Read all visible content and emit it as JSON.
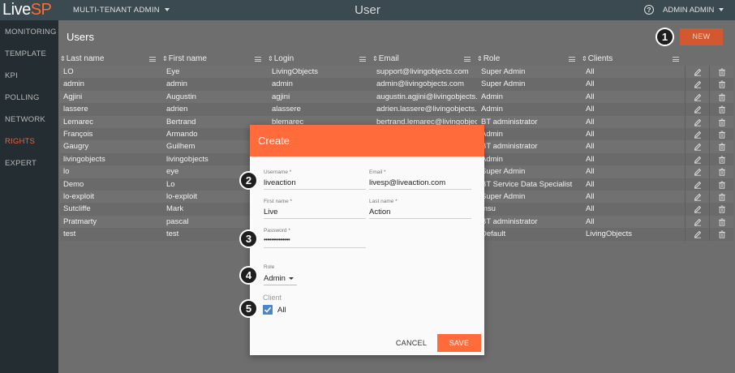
{
  "topbar": {
    "logo_live": "Live",
    "logo_sp": "SP",
    "tenant": "MULTI-TENANT ADMIN",
    "title": "User",
    "help": "?",
    "user": "ADMIN ADMIN"
  },
  "sidebar": {
    "items": [
      {
        "label": "MONITORING"
      },
      {
        "label": "TEMPLATE"
      },
      {
        "label": "KPI"
      },
      {
        "label": "POLLING"
      },
      {
        "label": "NETWORK"
      },
      {
        "label": "RIGHTS"
      },
      {
        "label": "EXPERT"
      }
    ]
  },
  "main": {
    "title": "Users",
    "new_button": "NEW",
    "columns": [
      "Last name",
      "First name",
      "Login",
      "Email",
      "Role",
      "Clients"
    ],
    "rows": [
      [
        "LO",
        "Eye",
        "LivingObjects",
        "support@livingobjects.com",
        "Super Admin",
        "All"
      ],
      [
        "admin",
        "admin",
        "admin",
        "admin@livingobjects.com",
        "Super Admin",
        "All"
      ],
      [
        "Agjini",
        "Augustin",
        "agjini",
        "augustin.agjini@livingobjects.com",
        "Admin",
        "All"
      ],
      [
        "lassere",
        "adrien",
        "alassere",
        "adrien.lassere@livingobjects.com",
        "Admin",
        "All"
      ],
      [
        "Lemarec",
        "Bertrand",
        "blemarec",
        "bertrand.lemarec@livingobjects.com",
        "BT administrator",
        "All"
      ],
      [
        "François",
        "Armando",
        "",
        "",
        "Admin",
        "All"
      ],
      [
        "Gaugry",
        "Guilhem",
        "",
        "",
        "BT administrator",
        "All"
      ],
      [
        "livingobjects",
        "livingobjects",
        "",
        "",
        "Admin",
        "All"
      ],
      [
        "lo",
        "eye",
        "",
        "",
        "Super Admin",
        "All"
      ],
      [
        "Demo",
        "Lo",
        "",
        "",
        "BT Service Data Specialist",
        "All"
      ],
      [
        "lo-exploit",
        "lo-exploit",
        "",
        "",
        "Super Admin",
        "All"
      ],
      [
        "Sutcliffe",
        "Mark",
        "",
        "",
        "msu",
        "All"
      ],
      [
        "Pratmarty",
        "pascal",
        "",
        "",
        "BT administrator",
        "All"
      ],
      [
        "test",
        "test",
        "",
        "",
        "Default",
        "LivingObjects"
      ]
    ]
  },
  "dialog": {
    "title": "Create",
    "username_label": "Username *",
    "username_value": "liveaction",
    "email_label": "Email *",
    "email_value": "livesp@liveaction.com",
    "firstname_label": "First name *",
    "firstname_value": "Live",
    "lastname_label": "Last name *",
    "lastname_value": "Action",
    "password_label": "Password *",
    "password_value": "••••••••••••••",
    "role_label": "Role",
    "role_value": "Admin",
    "client_label": "Client",
    "client_all": "All",
    "cancel": "CANCEL",
    "save": "SAVE"
  },
  "markers": [
    "1",
    "2",
    "3",
    "4",
    "5"
  ],
  "colors": {
    "accent": "#ff6b3b",
    "topbar": "#3b4a50",
    "sidebar": "#242e32",
    "checkbox": "#4a86c8"
  }
}
